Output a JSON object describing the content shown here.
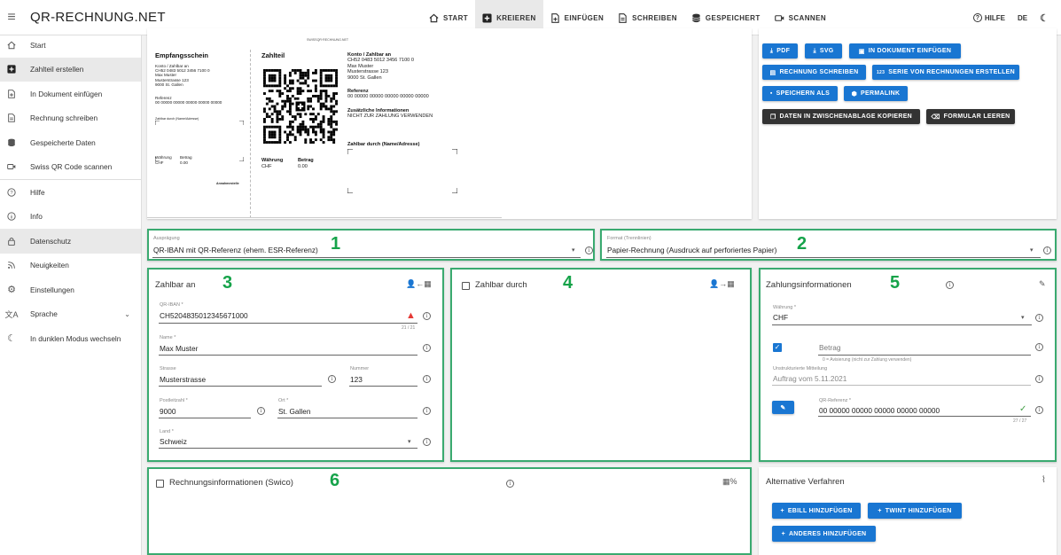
{
  "app": {
    "title": "QR-RECHNUNG.NET"
  },
  "topnav": [
    {
      "label": "START",
      "icon": "home-icon"
    },
    {
      "label": "KREIEREN",
      "icon": "plus-box-icon",
      "active": true
    },
    {
      "label": "EINFÜGEN",
      "icon": "file-plus-icon"
    },
    {
      "label": "SCHREIBEN",
      "icon": "file-text-icon"
    },
    {
      "label": "GESPEICHERT",
      "icon": "database-icon"
    },
    {
      "label": "SCANNEN",
      "icon": "camera-icon"
    }
  ],
  "topright": {
    "help": "HILFE",
    "lang": "DE"
  },
  "sidebar": [
    {
      "label": "Start",
      "icon": "home-icon"
    },
    {
      "label": "Zahlteil erstellen",
      "icon": "plus-box-icon",
      "active": true
    },
    {
      "label": "In Dokument einfügen",
      "icon": "file-plus-icon"
    },
    {
      "label": "Rechnung schreiben",
      "icon": "file-text-icon"
    },
    {
      "label": "Gespeicherte Daten",
      "icon": "database-icon"
    },
    {
      "label": "Swiss QR Code scannen",
      "icon": "camera-icon"
    },
    {
      "label": "Hilfe",
      "icon": "help-icon"
    },
    {
      "label": "Info",
      "icon": "info-icon"
    },
    {
      "label": "Datenschutz",
      "icon": "lock-icon",
      "active": true
    },
    {
      "label": "Neuigkeiten",
      "icon": "rss-icon"
    },
    {
      "label": "Einstellungen",
      "icon": "gear-icon"
    },
    {
      "label": "Sprache",
      "icon": "translate-icon"
    },
    {
      "label": "In dunklen Modus wechseln",
      "icon": "moon-icon"
    }
  ],
  "preview": {
    "header_small": "SWISSQR·RECHNUNG.NET",
    "receipt_title": "Empfangsschein",
    "receipt_account": "Konto / Zahlbar an\nCH52 0483 5012 3456 7100 0\nMax Muster\nMusterstrasse 123\n9000 St. Gallen",
    "receipt_ref": "Referenz\n00 00000 00000 00000 00000 00000",
    "receipt_payer": "Zahlbar durch (Name/Adresse)",
    "receipt_currency": "Währung\nCHF",
    "receipt_amount": "Betrag\n0.00",
    "receipt_accept": "Annahmestelle",
    "pay_title": "Zahlteil",
    "pay_currency_label": "Währung",
    "pay_currency": "CHF",
    "pay_amount_label": "Betrag",
    "pay_amount": "0.00",
    "info_account_label": "Konto / Zahlbar an",
    "info_account": "CH52 0483 5012 3456 7100 0\nMax Muster\nMusterstrasse 123\n9000 St. Gallen",
    "info_ref_label": "Referenz",
    "info_ref": "00 00000 00000 00000 00000 00000",
    "info_add_label": "Zusätzliche Informationen",
    "info_add": "NICHT ZUR ZAHLUNG VERWENDEN",
    "info_payer_label": "Zahlbar durch (Name/Adresse)"
  },
  "actions": {
    "pdf": "PDF",
    "svg": "SVG",
    "insert": "IN DOKUMENT EINFÜGEN",
    "write": "RECHNUNG SCHREIBEN",
    "series": "SERIE VON RECHNUNGEN ERSTELLEN",
    "save": "SPEICHERN ALS",
    "permalink": "PERMALINK",
    "copy": "DATEN IN ZWISCHENABLAGE KOPIEREN",
    "clear": "FORMULAR LEEREN"
  },
  "annotations": {
    "n1": "1",
    "n2": "2",
    "n3": "3",
    "n4": "4",
    "n5": "5",
    "n6": "6"
  },
  "auspraegung": {
    "label": "Ausprägung",
    "value": "QR-IBAN mit QR-Referenz (ehem. ESR-Referenz)"
  },
  "format": {
    "label": "Format (Trennlinien)",
    "value": "Papier-Rechnung (Ausdruck auf perforiertes Papier)"
  },
  "zahlbar_an": {
    "title": "Zahlbar an",
    "iban_label": "QR-IBAN *",
    "iban": "CH5204835012345671000",
    "iban_count": "21 / 21",
    "name_label": "Name *",
    "name": "Max Muster",
    "street_label": "Strasse",
    "street": "Musterstrasse",
    "number_label": "Nummer",
    "number": "123",
    "zip_label": "Postleitzahl *",
    "zip": "9000",
    "city_label": "Ort *",
    "city": "St. Gallen",
    "country_label": "Land *",
    "country": "Schweiz"
  },
  "zahlbar_durch": {
    "title": "Zahlbar durch"
  },
  "zahlung": {
    "title": "Zahlungsinformationen",
    "currency_label": "Währung *",
    "currency": "CHF",
    "amount_placeholder": "Betrag",
    "amount_hint": "0 = Avisierung (nicht zur Zahlung verwenden)",
    "message_label": "Unstrukturierte Mitteilung",
    "message": "Auftrag vom 5.11.2021",
    "ref_label": "QR-Referenz *",
    "ref": "00 00000 00000 00000 00000 00000",
    "ref_count": "27 / 27"
  },
  "rechnung": {
    "title": "Rechnungsinformationen (Swico)"
  },
  "alternativ": {
    "title": "Alternative Verfahren",
    "ebill": "EBILL HINZUFÜGEN",
    "twint": "TWINT HINZUFÜGEN",
    "other": "ANDERES HINZUFÜGEN"
  },
  "colors": {
    "primary": "#1976d2",
    "dark_button": "#333333",
    "highlight": "#3aaa70",
    "annotation": "#16a34a",
    "error": "#e53935",
    "check": "#43a047"
  }
}
